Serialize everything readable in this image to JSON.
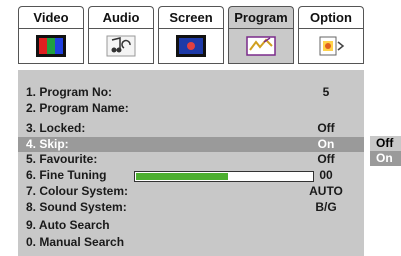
{
  "tabs": [
    {
      "label": "Video",
      "icon": "video-bars-icon"
    },
    {
      "label": "Audio",
      "icon": "audio-notes-icon"
    },
    {
      "label": "Screen",
      "icon": "screen-icon"
    },
    {
      "label": "Program",
      "icon": "program-antenna-icon",
      "active": true
    },
    {
      "label": "Option",
      "icon": "option-settings-icon"
    }
  ],
  "program": {
    "items": [
      {
        "label": "1. Program No:",
        "value": "5"
      },
      {
        "label": "2. Program Name:",
        "value": ""
      },
      {
        "label": "3. Locked:",
        "value": "Off"
      },
      {
        "label": "4. Skip:",
        "value": "On",
        "highlighted": true
      },
      {
        "label": "5. Favourite:",
        "value": "Off"
      },
      {
        "label": "6. Fine Tuning",
        "value": "00",
        "level": 0.52
      },
      {
        "label": "7. Colour System:",
        "value": "AUTO"
      },
      {
        "label": "8. Sound System:",
        "value": "B/G"
      },
      {
        "label": "9. Auto Search",
        "value": ""
      },
      {
        "label": "0. Manual Search",
        "value": ""
      }
    ]
  },
  "skip_popup": {
    "options": [
      "Off",
      "On"
    ],
    "selected": "On"
  },
  "colors": {
    "panel": "#c8c8c8",
    "highlight": "#9a9a9a",
    "tab_active": "#c9c9c9",
    "fine_bar": "#4caf2f"
  }
}
